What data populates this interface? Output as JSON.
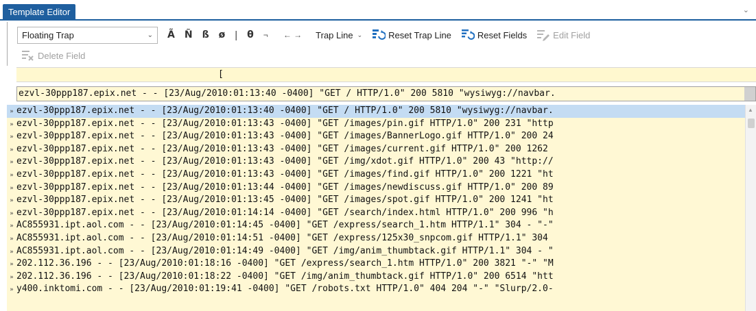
{
  "app": {
    "tab_title": "Template Editor"
  },
  "toolbar": {
    "trap_select_value": "Floating Trap",
    "special_chars": [
      "Ã",
      "Ñ",
      "ß",
      "ø"
    ],
    "separator_char": "|",
    "theta": "θ",
    "not_sign": "¬",
    "arrows": "← →",
    "trap_line_label": "Trap Line",
    "reset_trap_line_label": "Reset Trap Line",
    "reset_fields_label": "Reset Fields",
    "edit_field_label": "Edit Field",
    "delete_field_label": "Delete Field"
  },
  "marker_bar": {
    "cursor_glyph": "["
  },
  "trap_line_text": "ezvl-30ppp187.epix.net - - [23/Aug/2010:01:13:40 -0400] \"GET / HTTP/1.0\" 200 5810 \"wysiwyg://navbar.",
  "rows": [
    {
      "text": "ezvl-30ppp187.epix.net - - [23/Aug/2010:01:13:40 -0400] \"GET / HTTP/1.0\" 200 5810 \"wysiwyg://navbar.",
      "selected": true
    },
    {
      "text": "ezvl-30ppp187.epix.net - - [23/Aug/2010:01:13:43 -0400] \"GET /images/pin.gif HTTP/1.0\" 200 231 \"http",
      "selected": false
    },
    {
      "text": "ezvl-30ppp187.epix.net - - [23/Aug/2010:01:13:43 -0400] \"GET /images/BannerLogo.gif HTTP/1.0\" 200 24",
      "selected": false
    },
    {
      "text": "ezvl-30ppp187.epix.net - - [23/Aug/2010:01:13:43 -0400] \"GET /images/current.gif HTTP/1.0\" 200 1262 ",
      "selected": false
    },
    {
      "text": "ezvl-30ppp187.epix.net - - [23/Aug/2010:01:13:43 -0400] \"GET /img/xdot.gif HTTP/1.0\" 200 43 \"http://",
      "selected": false
    },
    {
      "text": "ezvl-30ppp187.epix.net - - [23/Aug/2010:01:13:43 -0400] \"GET /images/find.gif HTTP/1.0\" 200 1221 \"ht",
      "selected": false
    },
    {
      "text": "ezvl-30ppp187.epix.net - - [23/Aug/2010:01:13:44 -0400] \"GET /images/newdiscuss.gif HTTP/1.0\" 200 89",
      "selected": false
    },
    {
      "text": "ezvl-30ppp187.epix.net - - [23/Aug/2010:01:13:45 -0400] \"GET /images/spot.gif HTTP/1.0\" 200 1241 \"ht",
      "selected": false
    },
    {
      "text": "ezvl-30ppp187.epix.net - - [23/Aug/2010:01:14:14 -0400] \"GET /search/index.html HTTP/1.0\" 200 996 \"h",
      "selected": false
    },
    {
      "text": "AC855931.ipt.aol.com - - [23/Aug/2010:01:14:45 -0400] \"GET /express/search_1.htm HTTP/1.1\" 304 - \"-\"",
      "selected": false
    },
    {
      "text": "AC855931.ipt.aol.com - - [23/Aug/2010:01:14:51 -0400] \"GET /express/125x30_snpcom.gif HTTP/1.1\" 304 ",
      "selected": false
    },
    {
      "text": "AC855931.ipt.aol.com - - [23/Aug/2010:01:14:49 -0400] \"GET /img/anim_thumbtack.gif HTTP/1.1\" 304 - \"",
      "selected": false
    },
    {
      "text": "202.112.36.196 - - [23/Aug/2010:01:18:16 -0400] \"GET /express/search_1.htm HTTP/1.0\" 200 3821 \"-\" \"M",
      "selected": false
    },
    {
      "text": "202.112.36.196 - - [23/Aug/2010:01:18:22 -0400] \"GET /img/anim_thumbtack.gif HTTP/1.0\" 200 6514 \"htt",
      "selected": false
    },
    {
      "text": "y400.inktomi.com - - [23/Aug/2010:01:19:41 -0400] \"GET /robots.txt HTTP/1.0\" 404 204 \"-\" \"Slurp/2.0-",
      "selected": false
    }
  ],
  "row_marker": "»"
}
